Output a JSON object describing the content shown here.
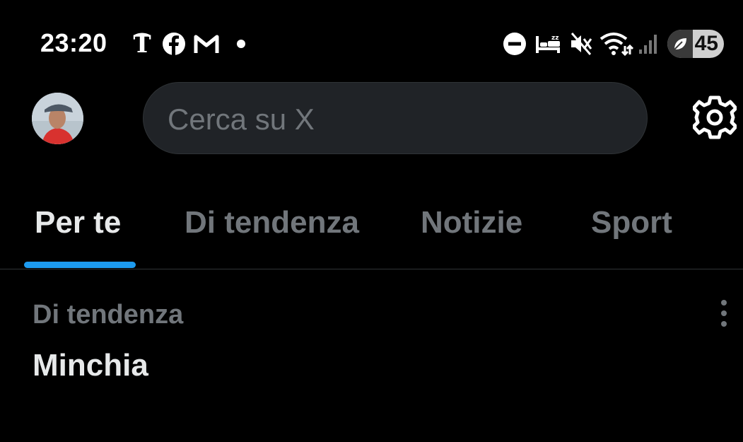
{
  "status_bar": {
    "time": "23:20",
    "notification_icons": [
      "nytimes-icon",
      "facebook-icon",
      "gmail-icon"
    ],
    "system_icons": [
      "do-not-disturb-icon",
      "sleep-mode-icon",
      "vibrate-icon",
      "wifi-icon",
      "cellular-signal-icon"
    ],
    "battery_level": "45",
    "battery_fraction": 0.45
  },
  "header": {
    "avatar": "avatar",
    "search_placeholder": "Cerca su X",
    "settings_icon": "gear-icon"
  },
  "tabs": [
    {
      "label": "Per te",
      "active": true
    },
    {
      "label": "Di tendenza",
      "active": false
    },
    {
      "label": "Notizie",
      "active": false
    },
    {
      "label": "Sport",
      "active": false
    }
  ],
  "trends": [
    {
      "context": "Di tendenza",
      "title": "Minchia"
    }
  ],
  "colors": {
    "background": "#000000",
    "accent": "#1d9bf0",
    "text_primary": "#e7e9ea",
    "text_secondary": "#71767b",
    "search_bg": "#202327"
  }
}
